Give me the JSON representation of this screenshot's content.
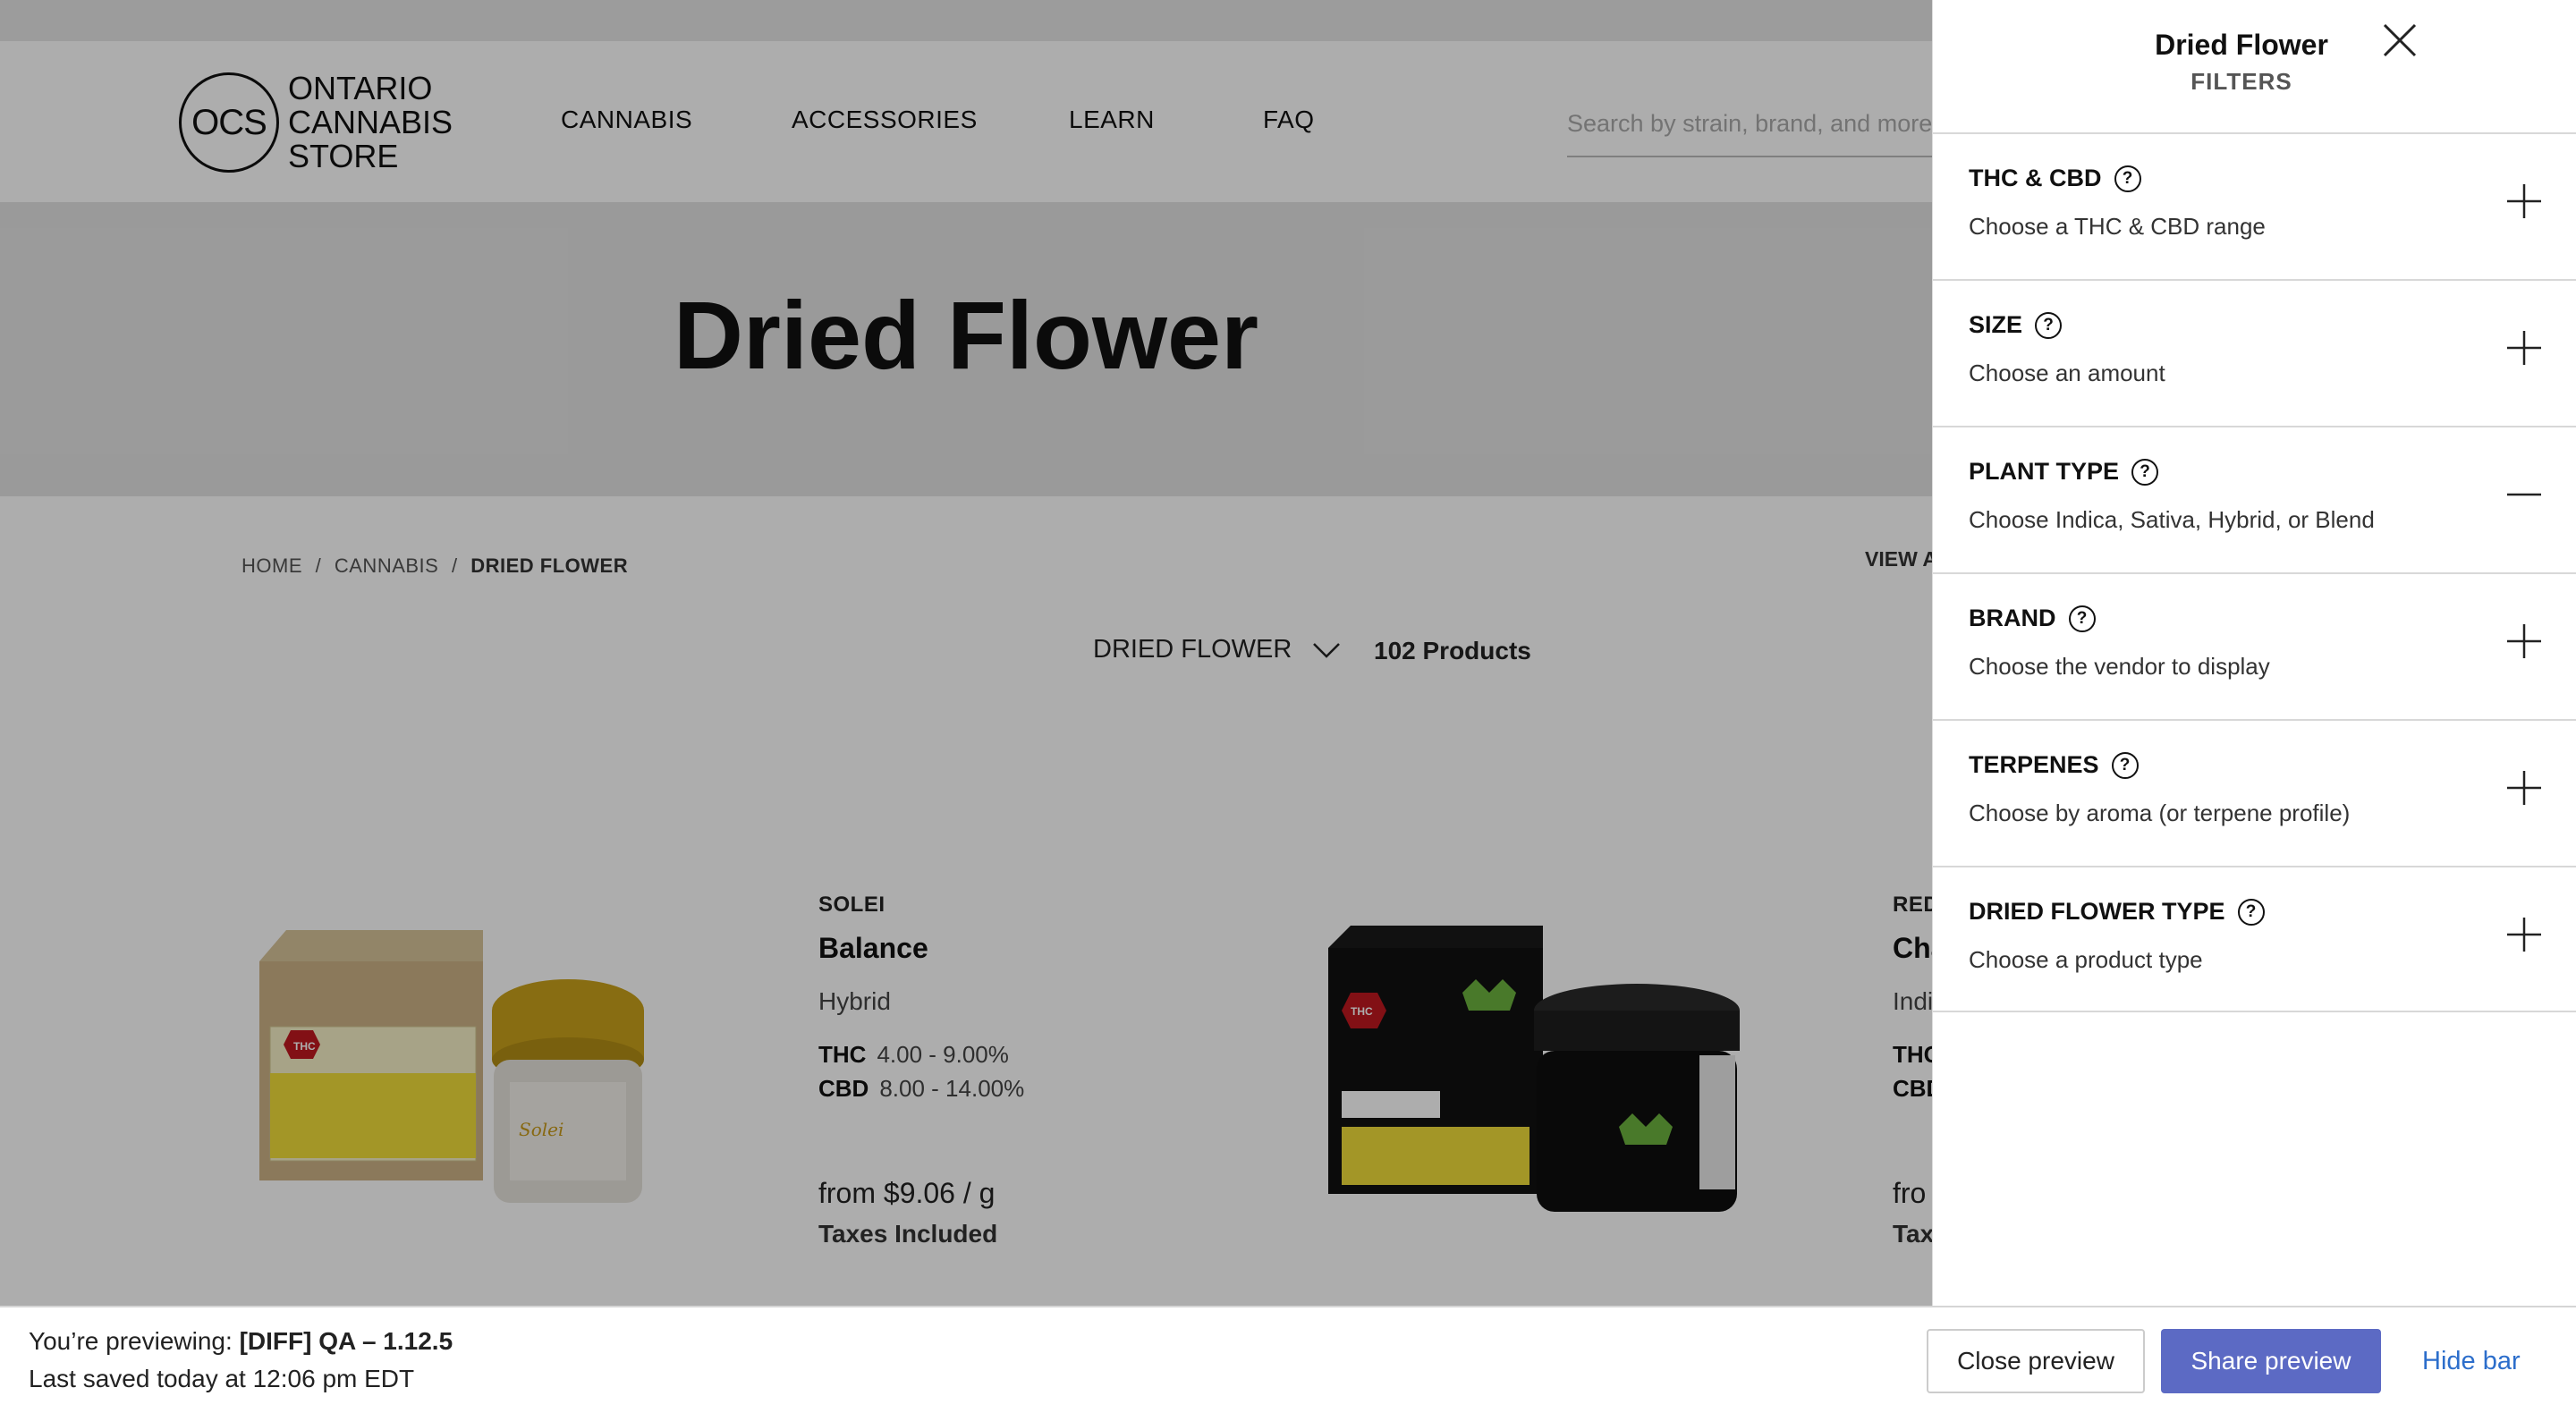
{
  "header": {
    "logo_mark": "OCS",
    "logo_line1": "ONTARIO",
    "logo_line2": "CANNABIS",
    "logo_line3": "STORE",
    "nav": [
      "CANNABIS",
      "ACCESSORIES",
      "LEARN",
      "FAQ"
    ],
    "search_placeholder": "Search by strain, brand, and more"
  },
  "hero": {
    "title": "Dried Flower"
  },
  "breadcrumb": {
    "home": "HOME",
    "sep": "/",
    "cannabis": "CANNABIS",
    "current": "DRIED FLOWER"
  },
  "view_all": "VIEW A",
  "listing": {
    "dropdown_label": "DRIED FLOWER",
    "count": "102 Products"
  },
  "products": [
    {
      "brand": "SOLEI",
      "name": "Balance",
      "type": "Hybrid",
      "thc_label": "THC",
      "thc": "4.00 - 9.00%",
      "cbd_label": "CBD",
      "cbd": "8.00 - 14.00%",
      "price": "from $9.06 / g",
      "tax": "Taxes Included"
    },
    {
      "brand": "RED",
      "name": "Cha",
      "type": "Indi",
      "thc_label": "THC",
      "cbd_label": "CBD",
      "price": "fro",
      "tax": "Tax"
    }
  ],
  "drawer": {
    "title": "Dried Flower",
    "subtitle": "FILTERS",
    "sections": [
      {
        "label": "THC & CBD",
        "desc": "Choose a THC & CBD range",
        "state": "collapsed"
      },
      {
        "label": "SIZE",
        "desc": "Choose an amount",
        "state": "collapsed"
      },
      {
        "label": "PLANT TYPE",
        "desc": "Choose Indica, Sativa, Hybrid, or Blend",
        "state": "expanded"
      },
      {
        "label": "BRAND",
        "desc": "Choose the vendor to display",
        "state": "collapsed"
      },
      {
        "label": "TERPENES",
        "desc": "Choose by aroma (or terpene profile)",
        "state": "collapsed"
      },
      {
        "label": "DRIED FLOWER TYPE",
        "desc": "Choose a product type",
        "state": "collapsed"
      }
    ],
    "help_glyph": "?"
  },
  "preview_bar": {
    "prefix": "You’re previewing:",
    "theme": "[DIFF] QA – 1.12.5",
    "saved": "Last saved today at 12:06 pm EDT",
    "close_label": "Close preview",
    "share_label": "Share preview",
    "hide_label": "Hide bar"
  },
  "colors": {
    "accent": "#5c6ac4",
    "link": "#2c6ecb",
    "overlay": "rgba(0,0,0,0.32)"
  }
}
